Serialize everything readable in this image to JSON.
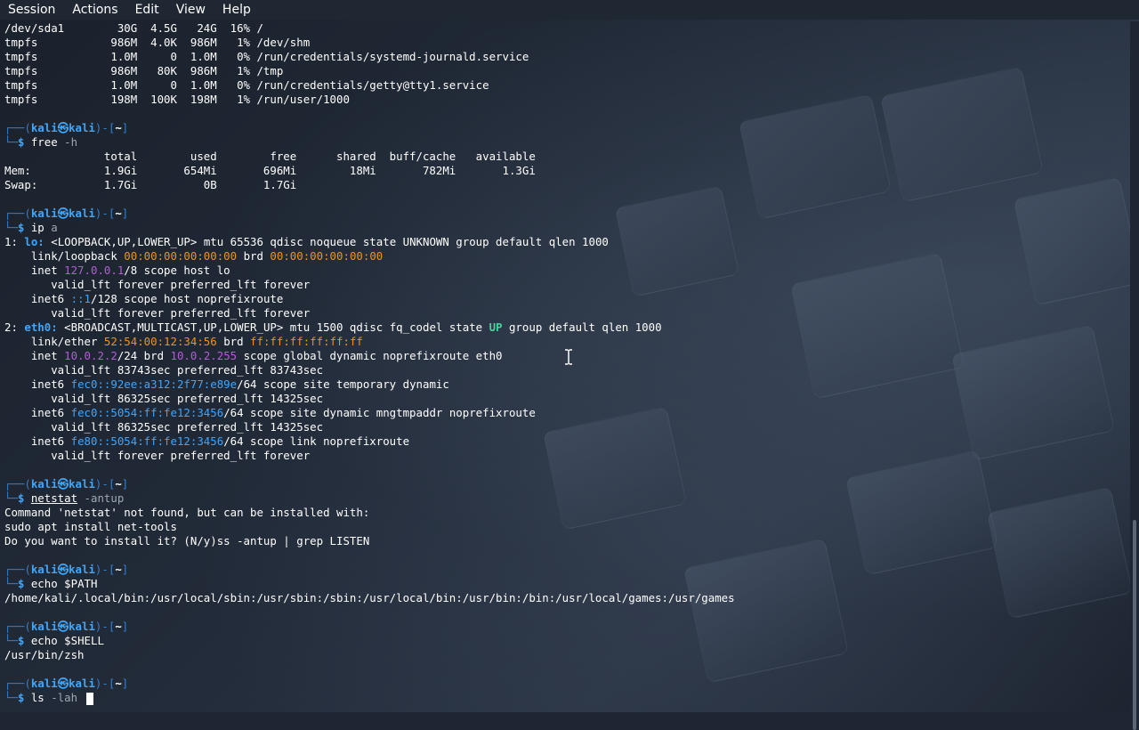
{
  "menu": [
    "Session",
    "Actions",
    "Edit",
    "View",
    "Help"
  ],
  "prompt": {
    "user": "kali",
    "host": "kali",
    "dir": "~"
  },
  "df_rows": [
    "/dev/sda1        30G  4.5G   24G  16% /",
    "tmpfs           986M  4.0K  986M   1% /dev/shm",
    "tmpfs           1.0M     0  1.0M   0% /run/credentials/systemd-journald.service",
    "tmpfs           986M   80K  986M   1% /tmp",
    "tmpfs           1.0M     0  1.0M   0% /run/credentials/getty@tty1.service",
    "tmpfs           198M  100K  198M   1% /run/user/1000"
  ],
  "cmd_free": {
    "name": "free",
    "args": "-h"
  },
  "free_rows": [
    "               total        used        free      shared  buff/cache   available",
    "Mem:           1.9Gi       654Mi       696Mi        18Mi       782Mi       1.3Gi",
    "Swap:          1.7Gi          0B       1.7Gi"
  ],
  "cmd_ip": {
    "name": "ip",
    "args": "a"
  },
  "ip": {
    "lo_idx": "1: ",
    "lo_name": "lo:",
    "lo_flags": " <LOOPBACK,UP,LOWER_UP> mtu 65536 qdisc noqueue state UNKNOWN group default qlen 1000",
    "lo_link_pre": "    link/loopback ",
    "lo_mac": "00:00:00:00:00:00",
    "lo_brd_word": " brd ",
    "lo_brd": "00:00:00:00:00:00",
    "lo_inet_pre": "    inet ",
    "lo_ip": "127.0.0.1",
    "lo_inet_post": "/8 scope host lo",
    "lo_valid1": "       valid_lft forever preferred_lft forever",
    "lo_inet6_pre": "    inet6 ",
    "lo_ip6": "::1",
    "lo_inet6_post": "/128 scope host noprefixroute",
    "lo_valid2": "       valid_lft forever preferred_lft forever",
    "eth_idx": "2: ",
    "eth_name": "eth0:",
    "eth_flags_a": " <BROADCAST,MULTICAST,UP,LOWER_UP> mtu 1500 qdisc fq_codel state ",
    "eth_state": "UP",
    "eth_flags_b": " group default qlen 1000",
    "eth_link_pre": "    link/ether ",
    "eth_mac": "52:54:00:12:34:56",
    "eth_brd_word": " brd ",
    "eth_brd_mac": "ff:ff:ff:ff:ff:ff",
    "eth_inet_pre": "    inet ",
    "eth_ip": "10.0.2.2",
    "eth_inet_mid": "/24 brd ",
    "eth_bcast": "10.0.2.255",
    "eth_inet_post": " scope global dynamic noprefixroute eth0",
    "eth_valid1": "       valid_lft 83743sec preferred_lft 83743sec",
    "eth_i6a_pre": "    inet6 ",
    "eth_i6a": "fec0::92ee:a312:2f77:e89e",
    "eth_i6a_post": "/64 scope site temporary dynamic",
    "eth_valid2": "       valid_lft 86325sec preferred_lft 14325sec",
    "eth_i6b_pre": "    inet6 ",
    "eth_i6b": "fec0::5054:ff:fe12:3456",
    "eth_i6b_post": "/64 scope site dynamic mngtmpaddr noprefixroute",
    "eth_valid3": "       valid_lft 86325sec preferred_lft 14325sec",
    "eth_i6c_pre": "    inet6 ",
    "eth_i6c": "fe80::5054:ff:fe12:3456",
    "eth_i6c_post": "/64 scope link noprefixroute",
    "eth_valid4": "       valid_lft forever preferred_lft forever"
  },
  "cmd_netstat": {
    "name": "netstat",
    "args": "-antup"
  },
  "netstat_out": [
    "Command 'netstat' not found, but can be installed with:",
    "sudo apt install net-tools",
    "Do you want to install it? (N/y)ss -antup | grep LISTEN"
  ],
  "cmd_path": {
    "name": "echo",
    "args": "$PATH"
  },
  "path_out": "/home/kali/.local/bin:/usr/local/sbin:/usr/sbin:/sbin:/usr/local/bin:/usr/bin:/bin:/usr/local/games:/usr/games",
  "cmd_shell": {
    "name": "echo",
    "args": "$SHELL"
  },
  "shell_out": "/usr/bin/zsh",
  "cmd_current": {
    "name": "ls",
    "args": "-lah "
  },
  "colors": {
    "prompt": "#2f7fd6",
    "ip": "#b45cd6",
    "mac": "#f0931c",
    "ipv6": "#3da7ff",
    "state_up": "#3fd89a"
  }
}
